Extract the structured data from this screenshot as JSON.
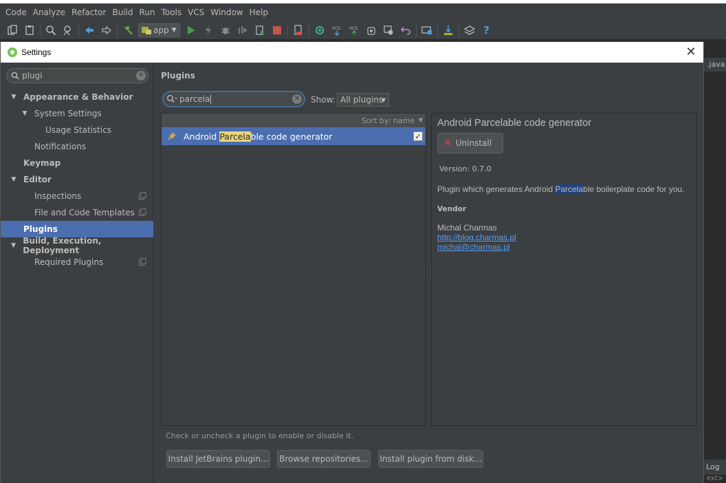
{
  "menubar": {
    "items": [
      "Code",
      "Analyze",
      "Refactor",
      "Build",
      "Run",
      "Tools",
      "VCS",
      "Window",
      "Help"
    ]
  },
  "toolbar": {
    "run_config": "app"
  },
  "ide_fragments": {
    "tab_suffix": ".java",
    "log_tab": "Log",
    "ext_text": "ext>"
  },
  "dialog": {
    "title": "Settings",
    "close_glyph": "✕"
  },
  "sidebar": {
    "search_value": "plugi",
    "tree": [
      {
        "label": "Appearance & Behavior",
        "level": 0,
        "arrow": "▼",
        "bold": true
      },
      {
        "label": "System Settings",
        "level": 1,
        "arrow": "▼",
        "bold": false
      },
      {
        "label": "Usage Statistics",
        "level": 2,
        "arrow": "",
        "bold": false
      },
      {
        "label": "Notifications",
        "level": 1,
        "arrow": "",
        "bold": false
      },
      {
        "label": "Keymap",
        "level": 0,
        "arrow": "",
        "bold": true
      },
      {
        "label": "Editor",
        "level": 0,
        "arrow": "▼",
        "bold": true
      },
      {
        "label": "Inspections",
        "level": 1,
        "arrow": "",
        "bold": false,
        "copy": true
      },
      {
        "label": "File and Code Templates",
        "level": 1,
        "arrow": "",
        "bold": false,
        "copy": true
      },
      {
        "label": "Plugins",
        "level": 0,
        "arrow": "",
        "bold": true,
        "selected": true
      },
      {
        "label": "Build, Execution, Deployment",
        "level": 0,
        "arrow": "▼",
        "bold": true
      },
      {
        "label": "Required Plugins",
        "level": 1,
        "arrow": "",
        "bold": false,
        "copy": true
      }
    ]
  },
  "plugins": {
    "title": "Plugins",
    "search_value": "parcela",
    "show_label": "Show:",
    "show_value": "All plugins",
    "sort_label": "Sort by: name",
    "list": [
      {
        "name_before": "Android ",
        "name_highlight": "Parcela",
        "name_after": "ble code generator",
        "checked": true
      }
    ],
    "detail": {
      "title": "Android Parcelable code generator",
      "uninstall_label": "Uninstall",
      "version": "Version: 0.7.0",
      "desc_before": "Plugin which generates Android ",
      "desc_highlight": "Parcela",
      "desc_after": "ble boilerplate code for you.",
      "vendor_label": "Vendor",
      "vendor_name": "Michal Charmas",
      "vendor_url": "http://blog.charmas.pl",
      "vendor_email": "michal@charmas.pl"
    },
    "hint": "Check or uncheck a plugin to enable or disable it.",
    "buttons": {
      "jetbrains": "Install JetBrains plugin...",
      "browse": "Browse repositories...",
      "disk": "Install plugin from disk..."
    }
  }
}
